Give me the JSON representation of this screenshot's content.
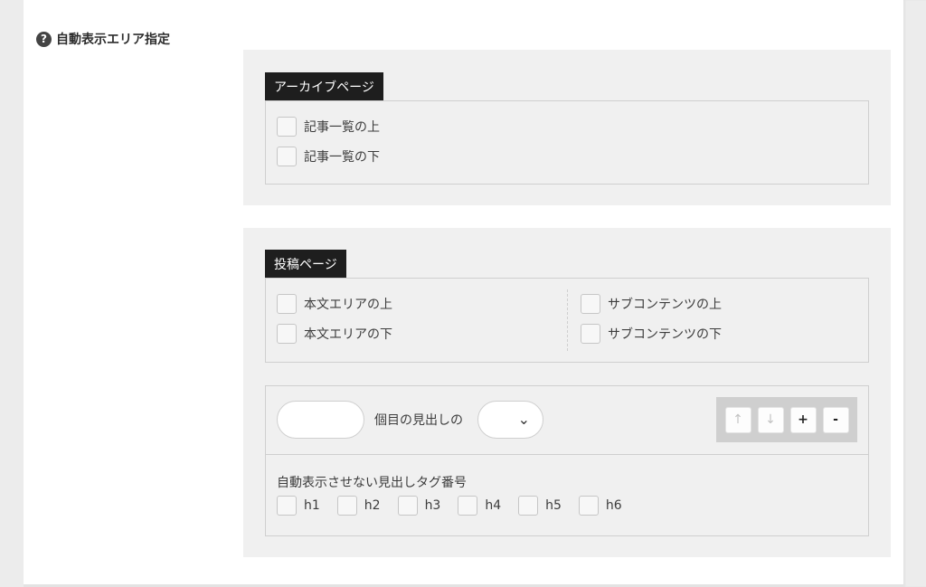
{
  "section": {
    "title": "自動表示エリア指定",
    "help_icon": "question-circle-icon",
    "help_glyph": "?"
  },
  "archive": {
    "label": "アーカイブページ",
    "options": [
      {
        "label": "記事一覧の上",
        "checked": false
      },
      {
        "label": "記事一覧の下",
        "checked": false
      }
    ]
  },
  "post": {
    "label": "投稿ページ",
    "left_options": [
      {
        "label": "本文エリアの上",
        "checked": false
      },
      {
        "label": "本文エリアの下",
        "checked": false
      }
    ],
    "right_options": [
      {
        "label": "サブコンテンツの上",
        "checked": false
      },
      {
        "label": "サブコンテンツの下",
        "checked": false
      }
    ],
    "position_rule": {
      "count_value": "",
      "middle_text": "個目の見出しの",
      "position_select_value": "",
      "chevron": "⌄",
      "buttons": {
        "up": "↑",
        "down": "↓",
        "add": "+",
        "remove": "-"
      }
    },
    "exclude": {
      "title": "自動表示させない見出しタグ番号",
      "headings": [
        "h1",
        "h2",
        "h3",
        "h4",
        "h5",
        "h6"
      ]
    }
  }
}
